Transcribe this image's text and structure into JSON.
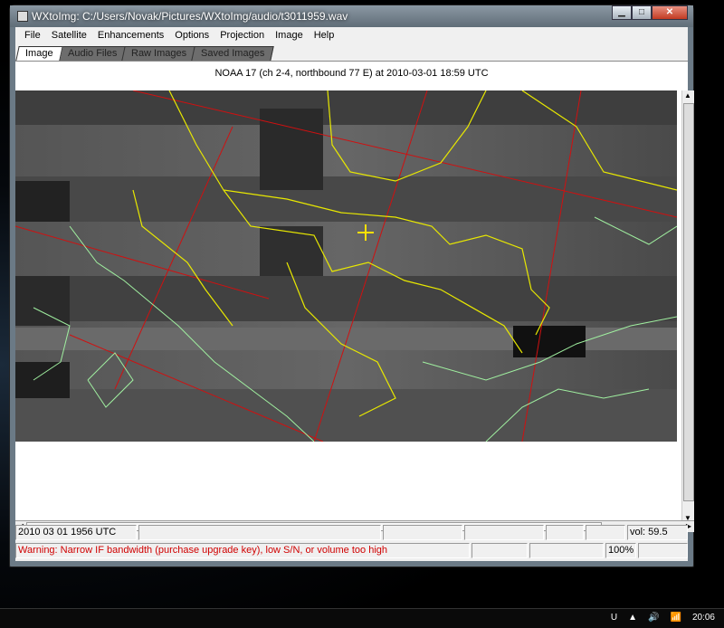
{
  "window": {
    "title": "WXtoImg: C:/Users/Novak/Pictures/WXtoImg/audio/t3011959.wav",
    "minimize": "▁",
    "maximize": "□",
    "close": "✕"
  },
  "menu": [
    "File",
    "Satellite",
    "Enhancements",
    "Options",
    "Projection",
    "Image",
    "Help"
  ],
  "tabs": [
    {
      "label": "Image",
      "active": true
    },
    {
      "label": "Audio Files"
    },
    {
      "label": "Raw Images"
    },
    {
      "label": "Saved Images"
    }
  ],
  "caption": "NOAA 17 (ch 2-4, northbound 77 E) at 2010-03-01 18:59 UTC",
  "status": {
    "row1": [
      "2010 03 01 1956 UTC",
      "",
      "",
      "",
      "",
      "",
      "vol: 59.5"
    ],
    "row2": [
      "Warning: Narrow IF bandwidth (purchase upgrade key), low S/N, or volume too high",
      "",
      "",
      "100%",
      ""
    ]
  },
  "taskbar": {
    "tray_items": [
      "U",
      "▲",
      "🔊",
      "📶"
    ],
    "clock": "20:06"
  },
  "colors": {
    "coastline": "#a0f0a0",
    "borders": "#e8e800",
    "graticule": "#d01010",
    "warning": "#d00000"
  }
}
